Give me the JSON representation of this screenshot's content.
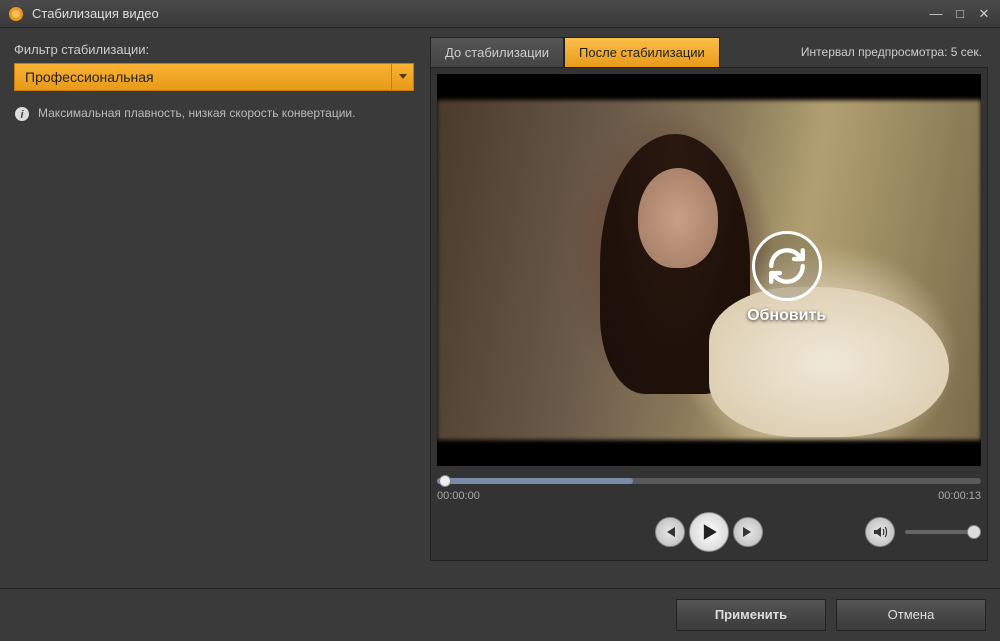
{
  "titlebar": {
    "title": "Стабилизация видео"
  },
  "leftPanel": {
    "filterLabel": "Фильтр стабилизации:",
    "dropdownValue": "Профессиональная",
    "infoText": "Максимальная плавность, низкая скорость конвертации."
  },
  "rightPanel": {
    "tabs": {
      "before": "До стабилизации",
      "after": "После стабилизации"
    },
    "previewInterval": "Интервал предпросмотра: 5 сек.",
    "refreshLabel": "Обновить",
    "timeStart": "00:00:00",
    "timeEnd": "00:00:13"
  },
  "footer": {
    "apply": "Применить",
    "cancel": "Отмена"
  }
}
